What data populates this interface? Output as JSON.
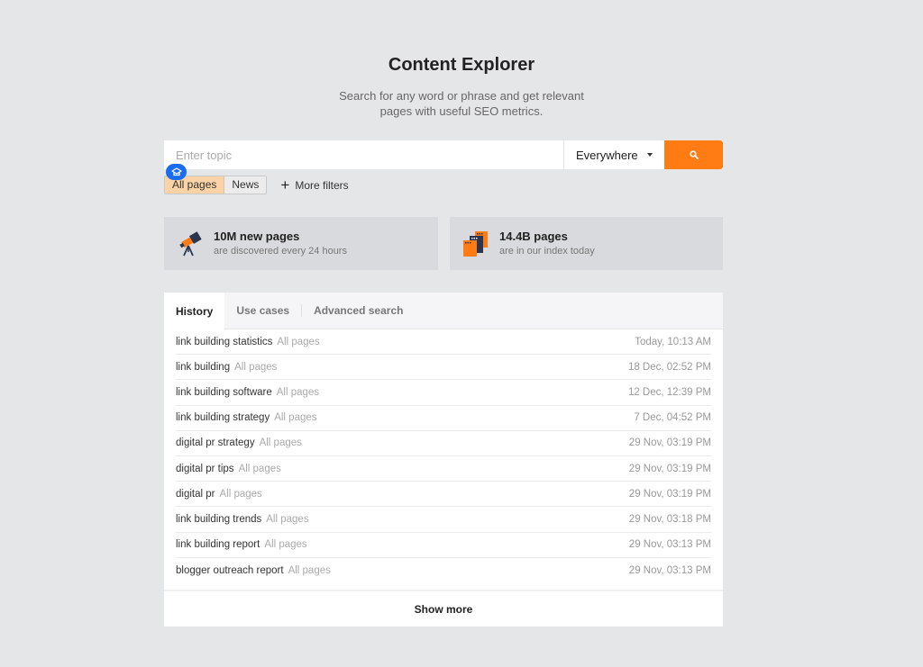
{
  "header": {
    "title": "Content Explorer",
    "subtitle_line1": "Search for any word or phrase and get relevant",
    "subtitle_line2": "pages with useful SEO metrics."
  },
  "search": {
    "placeholder": "Enter topic",
    "value": "",
    "scope": "Everywhere",
    "button_icon": "search-icon",
    "accent_color": "#ff7b14"
  },
  "filters": {
    "segments": [
      {
        "label": "All pages",
        "active": true
      },
      {
        "label": "News",
        "active": false
      }
    ],
    "more_filters_label": "More filters"
  },
  "stats": [
    {
      "icon": "telescope-icon",
      "title": "10M new pages",
      "subtitle": "are discovered every 24 hours"
    },
    {
      "icon": "pages-stack-icon",
      "title": "14.4B pages",
      "subtitle": "are in our index today"
    }
  ],
  "history": {
    "tabs": [
      {
        "label": "History",
        "active": true
      },
      {
        "label": "Use cases",
        "active": false
      },
      {
        "label": "Advanced search",
        "active": false
      }
    ],
    "rows": [
      {
        "query": "link building statistics",
        "scope": "All pages",
        "time": "Today, 10:13 AM"
      },
      {
        "query": "link building",
        "scope": "All pages",
        "time": "18 Dec, 02:52 PM"
      },
      {
        "query": "link building software",
        "scope": "All pages",
        "time": "12 Dec, 12:39 PM"
      },
      {
        "query": "link building strategy",
        "scope": "All pages",
        "time": "7 Dec, 04:52 PM"
      },
      {
        "query": "digital pr strategy",
        "scope": "All pages",
        "time": "29 Nov, 03:19 PM"
      },
      {
        "query": "digital pr tips",
        "scope": "All pages",
        "time": "29 Nov, 03:19 PM"
      },
      {
        "query": "digital pr",
        "scope": "All pages",
        "time": "29 Nov, 03:19 PM"
      },
      {
        "query": "link building trends",
        "scope": "All pages",
        "time": "29 Nov, 03:18 PM"
      },
      {
        "query": "link building report",
        "scope": "All pages",
        "time": "29 Nov, 03:13 PM"
      },
      {
        "query": "blogger outreach report",
        "scope": "All pages",
        "time": "29 Nov, 03:13 PM"
      }
    ],
    "show_more_label": "Show more"
  }
}
